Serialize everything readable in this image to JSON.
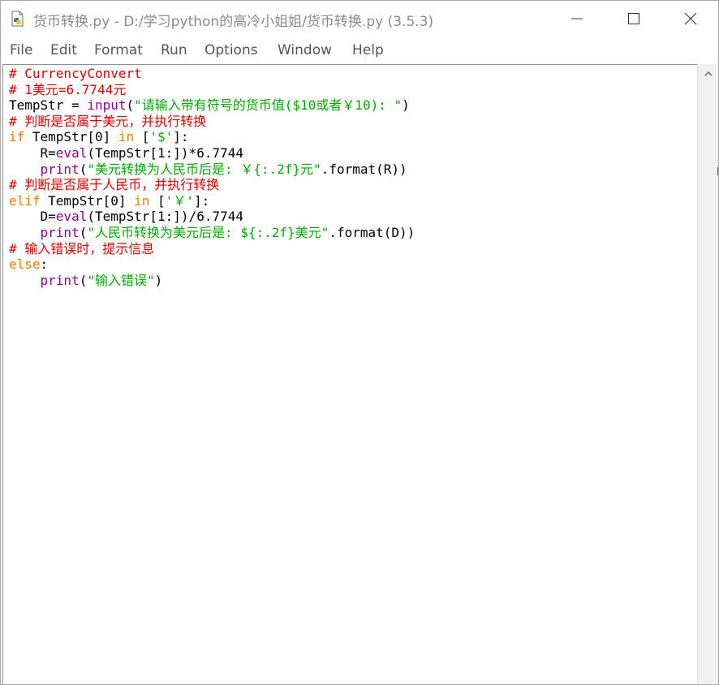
{
  "window": {
    "title": "货币转换.py - D:/学习python的高冷小姐姐/货币转换.py (3.5.3)"
  },
  "menu": {
    "items": [
      "File",
      "Edit",
      "Format",
      "Run",
      "Options",
      "Window",
      "Help"
    ]
  },
  "editor": {
    "lines": [
      [
        {
          "t": "c",
          "v": "# CurrencyConvert"
        }
      ],
      [
        {
          "t": "c",
          "v": "# 1美元=6.7744元"
        }
      ],
      [
        {
          "t": "n",
          "v": "TempStr = "
        },
        {
          "t": "b",
          "v": "input"
        },
        {
          "t": "n",
          "v": "("
        },
        {
          "t": "s",
          "v": "\"请输入带有符号的货币值($10或者￥10): \""
        },
        {
          "t": "n",
          "v": ")"
        }
      ],
      [
        {
          "t": "c",
          "v": "# 判断是否属于美元，并执行转换"
        }
      ],
      [
        {
          "t": "k",
          "v": "if"
        },
        {
          "t": "n",
          "v": " TempStr[0] "
        },
        {
          "t": "k",
          "v": "in"
        },
        {
          "t": "n",
          "v": " ["
        },
        {
          "t": "s",
          "v": "'$'"
        },
        {
          "t": "n",
          "v": "]:"
        }
      ],
      [
        {
          "t": "n",
          "v": "    R="
        },
        {
          "t": "b",
          "v": "eval"
        },
        {
          "t": "n",
          "v": "(TempStr[1:])*6.7744"
        }
      ],
      [
        {
          "t": "n",
          "v": "    "
        },
        {
          "t": "b",
          "v": "print"
        },
        {
          "t": "n",
          "v": "("
        },
        {
          "t": "s",
          "v": "\"美元转换为人民币后是: ￥{:.2f}元\""
        },
        {
          "t": "n",
          "v": ".format(R))"
        }
      ],
      [
        {
          "t": "c",
          "v": "# 判断是否属于人民币，并执行转换"
        }
      ],
      [
        {
          "t": "k",
          "v": "elif"
        },
        {
          "t": "n",
          "v": " TempStr[0] "
        },
        {
          "t": "k",
          "v": "in"
        },
        {
          "t": "n",
          "v": " ["
        },
        {
          "t": "s",
          "v": "'￥'"
        },
        {
          "t": "n",
          "v": "]:"
        }
      ],
      [
        {
          "t": "n",
          "v": "    D="
        },
        {
          "t": "b",
          "v": "eval"
        },
        {
          "t": "n",
          "v": "(TempStr[1:])/6.7744"
        }
      ],
      [
        {
          "t": "n",
          "v": "    "
        },
        {
          "t": "b",
          "v": "print"
        },
        {
          "t": "n",
          "v": "("
        },
        {
          "t": "s",
          "v": "\"人民币转换为美元后是: ${:.2f}美元\""
        },
        {
          "t": "n",
          "v": ".format(D))"
        }
      ],
      [
        {
          "t": "c",
          "v": "# 输入错误时，提示信息"
        }
      ],
      [
        {
          "t": "k",
          "v": "else"
        },
        {
          "t": "n",
          "v": ":"
        }
      ],
      [
        {
          "t": "n",
          "v": "    "
        },
        {
          "t": "b",
          "v": "print"
        },
        {
          "t": "n",
          "v": "("
        },
        {
          "t": "s",
          "v": "\"输入错误\""
        },
        {
          "t": "n",
          "v": ")"
        }
      ]
    ]
  },
  "colors": {
    "comment": "#dd0000",
    "string": "#00aa00",
    "keyword": "#ff7700",
    "builtin": "#900090"
  },
  "icons": {
    "app": "python-file-icon",
    "minimize": "minimize-icon",
    "maximize": "maximize-icon",
    "close": "close-icon",
    "scroll_up": "scroll-up-arrow-icon"
  }
}
